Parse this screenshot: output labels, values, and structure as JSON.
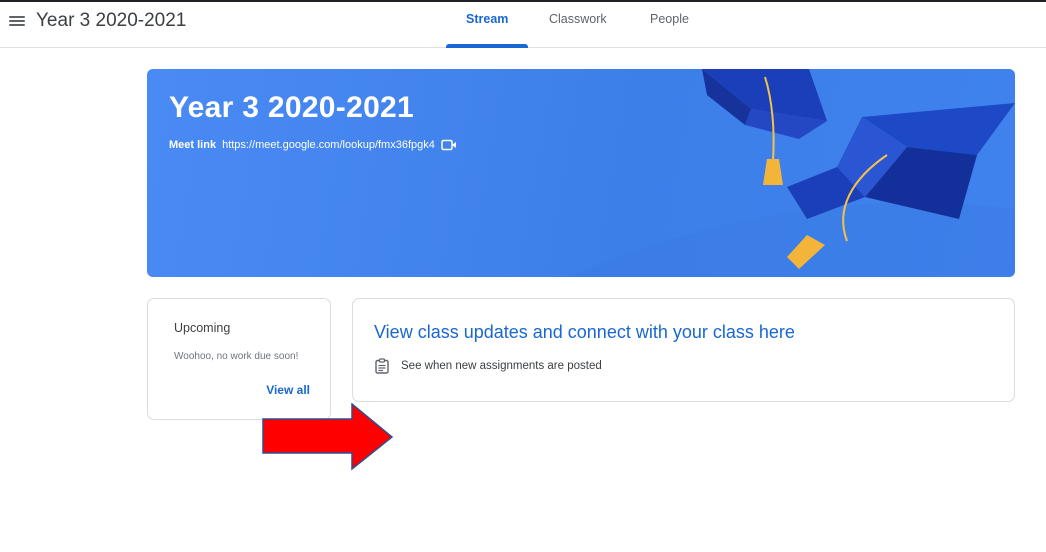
{
  "header": {
    "class_title": "Year 3 2020-2021",
    "tabs": [
      {
        "label": "Stream",
        "active": true
      },
      {
        "label": "Classwork",
        "active": false
      },
      {
        "label": "People",
        "active": false
      }
    ]
  },
  "banner": {
    "title": "Year 3 2020-2021",
    "meet_label": "Meet link",
    "meet_url": "https://meet.google.com/lookup/fmx36fpgk4",
    "color": "#4285f4"
  },
  "upcoming": {
    "title": "Upcoming",
    "message": "Woohoo, no work due soon!",
    "link": "View all"
  },
  "updates": {
    "title": "View class updates and connect with your class here",
    "item": "See when new assignments are posted"
  },
  "colors": {
    "accent": "#1967d2",
    "annotation_arrow": "#ff0000"
  }
}
